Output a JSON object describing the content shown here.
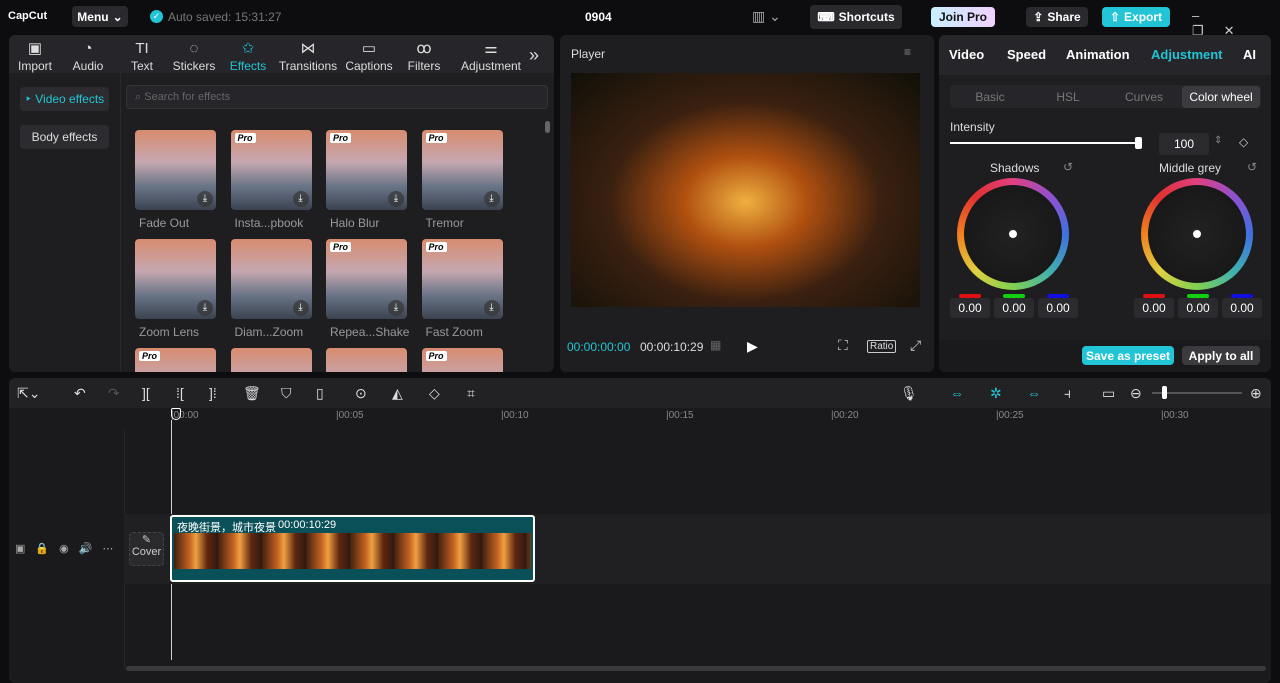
{
  "app": {
    "logo": "CapCut",
    "menu": "Menu",
    "autosave": "Auto saved: 15:31:27",
    "project": "0904",
    "shortcuts": "Shortcuts",
    "join_pro": "Join Pro",
    "share": "Share",
    "export": "Export"
  },
  "toolbar": [
    {
      "label": "Import",
      "icon": "import-icon",
      "g": "▣"
    },
    {
      "label": "Audio",
      "icon": "audio-icon",
      "g": "◔"
    },
    {
      "label": "Text",
      "icon": "text-icon",
      "g": "TI"
    },
    {
      "label": "Stickers",
      "icon": "sticker-icon",
      "g": "◌"
    },
    {
      "label": "Effects",
      "icon": "effects-icon",
      "g": "✩"
    },
    {
      "label": "Transitions",
      "icon": "transitions-icon",
      "g": "⋈"
    },
    {
      "label": "Captions",
      "icon": "captions-icon",
      "g": "▭"
    },
    {
      "label": "Filters",
      "icon": "filters-icon",
      "g": "ꝏ"
    },
    {
      "label": "Adjustment",
      "icon": "adjustment-icon",
      "g": "⚌"
    }
  ],
  "effects": {
    "categories": [
      "Video effects",
      "Body effects"
    ],
    "search_placeholder": "Search for effects",
    "items": [
      {
        "label": "Fade Out",
        "pro": false
      },
      {
        "label": "Insta...pbook",
        "pro": true
      },
      {
        "label": "Halo Blur",
        "pro": true
      },
      {
        "label": "Tremor",
        "pro": true
      },
      {
        "label": "Zoom Lens",
        "pro": false
      },
      {
        "label": "Diam...Zoom",
        "pro": false
      },
      {
        "label": "Repea...Shake",
        "pro": true
      },
      {
        "label": "Fast Zoom",
        "pro": true
      },
      {
        "label": "",
        "pro": true
      },
      {
        "label": "",
        "pro": false
      },
      {
        "label": "",
        "pro": false
      },
      {
        "label": "",
        "pro": true
      }
    ],
    "pro_badge": "Pro"
  },
  "player": {
    "title": "Player",
    "current": "00:00:00:00",
    "total": "00:00:10:29",
    "ratio": "Ratio"
  },
  "inspector": {
    "tabs": [
      "Video",
      "Speed",
      "Animation",
      "Adjustment",
      "AI"
    ],
    "active_tab": "Adjustment",
    "subtabs": [
      "Basic",
      "HSL",
      "Curves",
      "Color wheel"
    ],
    "intensity_label": "Intensity",
    "intensity": 100,
    "wheels": [
      {
        "name": "Shadows",
        "values": [
          "0.00",
          "0.00",
          "0.00"
        ]
      },
      {
        "name": "Middle grey",
        "values": [
          "0.00",
          "0.00",
          "0.00"
        ]
      }
    ],
    "save_preset": "Save as preset",
    "apply_all": "Apply to all"
  },
  "timeline": {
    "ticks": [
      "00:00",
      "00:05",
      "00:10",
      "00:15",
      "00:20",
      "00:25",
      "00:30"
    ],
    "clip_title": "夜晚街景，城市夜景",
    "clip_duration": "00:00:10:29",
    "cover": "Cover"
  },
  "colors": {
    "accent": "#22c5d5",
    "clip": "#0a5058"
  }
}
